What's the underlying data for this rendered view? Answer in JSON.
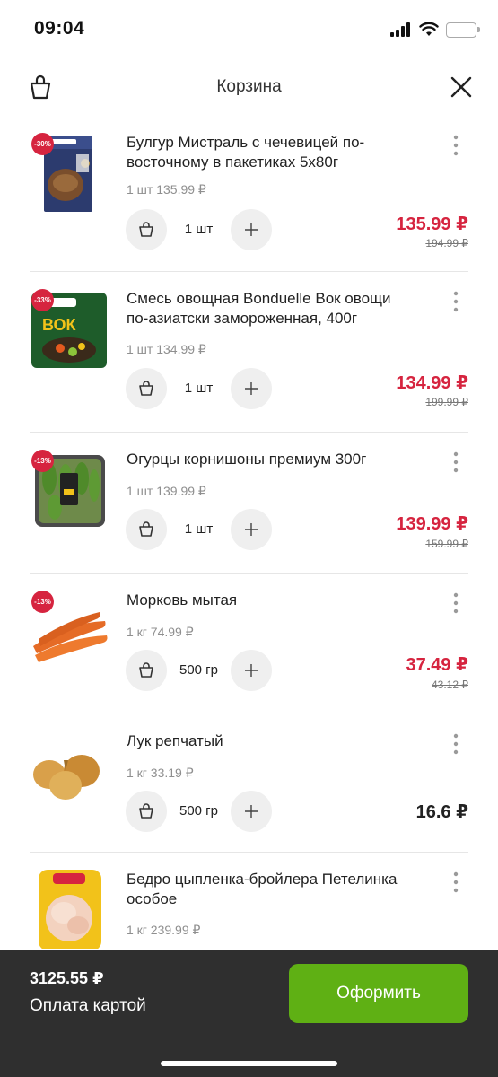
{
  "status_bar": {
    "time": "09:04"
  },
  "header": {
    "title": "Корзина"
  },
  "items": [
    {
      "name": "Булгур Мистраль с чечевицей по-восточному в пакетиках 5х80г",
      "unit_price": "1 шт 135.99 ₽",
      "quantity": "1 шт",
      "price": "135.99 ₽",
      "old_price": "194.99 ₽",
      "discount": "-30%",
      "image": "bulgur-package"
    },
    {
      "name": "Смесь овощная Bonduelle Вок овощи по-азиатски замороженная, 400г",
      "unit_price": "1 шт 134.99 ₽",
      "quantity": "1 шт",
      "price": "134.99 ₽",
      "old_price": "199.99 ₽",
      "discount": "-33%",
      "image": "bonduelle-wok-package"
    },
    {
      "name": "Огурцы корнишоны премиум 300г",
      "unit_price": "1 шт 139.99 ₽",
      "quantity": "1 шт",
      "price": "139.99 ₽",
      "old_price": "159.99 ₽",
      "discount": "-13%",
      "image": "cucumbers-tray"
    },
    {
      "name": "Морковь мытая",
      "unit_price": "1 кг 74.99 ₽",
      "quantity": "500 гр",
      "price": "37.49 ₽",
      "old_price": "43.12 ₽",
      "discount": "-13%",
      "image": "carrots"
    },
    {
      "name": "Лук репчатый",
      "unit_price": "1 кг 33.19 ₽",
      "quantity": "500 гр",
      "price": "16.6 ₽",
      "old_price": "",
      "discount": "",
      "image": "onions"
    },
    {
      "name": "Бедро цыпленка-бройлера Петелинка особое",
      "unit_price": "1 кг 239.99 ₽",
      "quantity": "",
      "price": "",
      "old_price": "",
      "discount": "",
      "image": "chicken-thigh-tray"
    }
  ],
  "footer": {
    "total": "3125.55 ₽",
    "payment_method": "Оплата картой",
    "checkout_label": "Оформить"
  },
  "colors": {
    "accent_red": "#d6243f",
    "checkout_green": "#5fb014",
    "footer_bg": "#2f2f2f"
  },
  "icons": [
    "signal-icon",
    "wifi-icon",
    "battery-icon",
    "trash-icon",
    "close-icon",
    "more-icon",
    "minus-trash-icon",
    "plus-icon"
  ]
}
